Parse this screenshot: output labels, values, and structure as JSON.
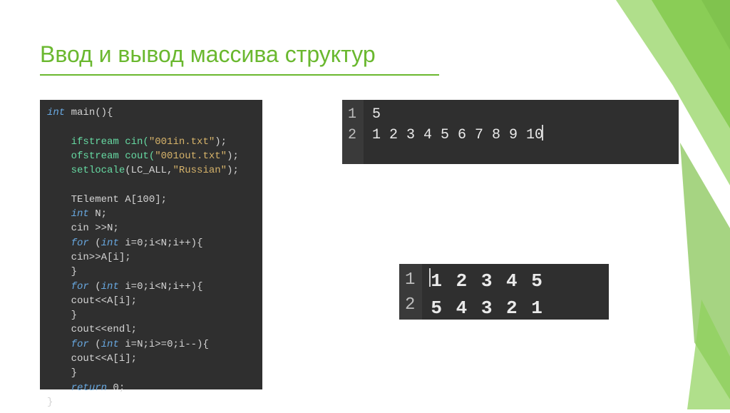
{
  "title": "Ввод и вывод массива структур",
  "code": {
    "l1a": "int",
    "l1b": " main(){",
    "l2a": "ifstream",
    "l2b": " cin(",
    "l2c": "\"001in.txt\"",
    "l2d": ");",
    "l3a": "ofstream",
    "l3b": " cout(",
    "l3c": "\"001out.txt\"",
    "l3d": ");",
    "l4a": "setlocale",
    "l4b": "(LC_ALL,",
    "l4c": "\"Russian\"",
    "l4d": ");",
    "l5": "TElement A[100];",
    "l6a": "int",
    "l6b": " N;",
    "l7": "cin >>N;",
    "l8a": "for",
    "l8b": " (",
    "l8c": "int",
    "l8d": " i=0;i<N;i++){",
    "l9": "    cin>>A[i];",
    "l10": "}",
    "l11a": "for",
    "l11b": " (",
    "l11c": "int",
    "l11d": " i=0;i<N;i++){",
    "l12": "    cout<<A[i];",
    "l13": "}",
    "l14": "cout<<endl;",
    "l15a": "for",
    "l15b": " (",
    "l15c": "int",
    "l15d": " i=N;i>=0;i--){",
    "l16": "    cout<<A[i];",
    "l17": "}",
    "l18a": "return",
    "l18b": " 0;",
    "l19": "}"
  },
  "panel1": {
    "gutter": [
      "1",
      "2"
    ],
    "line1": "5",
    "line2": "1 2 3 4 5 6 7 8 9 10"
  },
  "panel2": {
    "gutter": [
      "1",
      "2"
    ],
    "line1": "1 2 3 4 5",
    "line2": "5 4 3 2 1"
  }
}
